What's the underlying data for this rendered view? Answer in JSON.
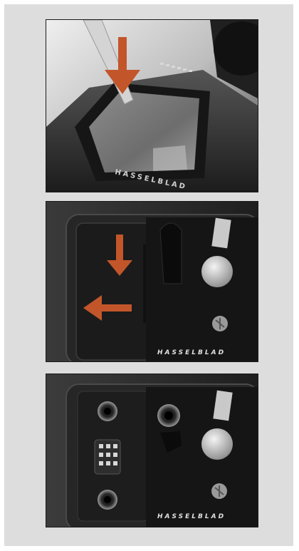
{
  "brand_mark": "HASSELBLAD",
  "figures": [
    {
      "id": "photo1",
      "description": "camera body seen from above, pointer and arrow toward sensor opening"
    },
    {
      "id": "photo2",
      "description": "connector cover, arrows down then left"
    },
    {
      "id": "photo3",
      "description": "connector panel with cover removed"
    }
  ],
  "colors": {
    "panel_bg": "#dddddd",
    "arrow": "#c2562a"
  }
}
